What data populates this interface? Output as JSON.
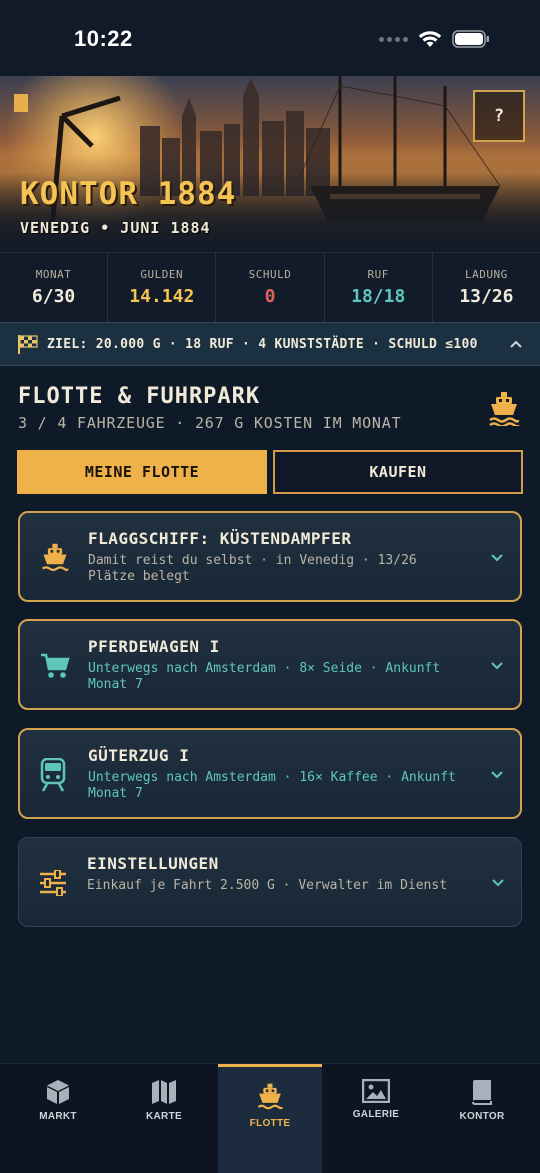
{
  "status_bar": {
    "time": "10:22"
  },
  "hero": {
    "title": "KONTOR 1884",
    "subtitle": "VENEDIG • JUNI 1884",
    "help_label": "?"
  },
  "stats": [
    {
      "label": "MONAT",
      "value": "6/30",
      "color": "#f1ead8"
    },
    {
      "label": "GULDEN",
      "value": "14.142",
      "color": "#f5c453"
    },
    {
      "label": "SCHULD",
      "value": "0",
      "color": "#e0625a"
    },
    {
      "label": "RUF",
      "value": "18/18",
      "color": "#5fc7b8"
    },
    {
      "label": "LADUNG",
      "value": "13/26",
      "color": "#f1ead8"
    }
  ],
  "goal": {
    "text": "ZIEL: 20.000 G · 18 RUF · 4 KUNSTSTÄDTE · SCHULD ≤100",
    "icon": "checkered-flag-icon"
  },
  "section": {
    "title": "FLOTTE & FUHRPARK",
    "subtitle": "3 / 4 FAHRZEUGE · 267 G KOSTEN IM MONAT",
    "icon": "ship-icon"
  },
  "tabs": {
    "fleet_label": "MEINE FLOTTE",
    "buy_label": "KAUFEN"
  },
  "cards": [
    {
      "title": "FLAGGSCHIFF: KÜSTENDAMPFER",
      "desc": "Damit reist du selbst · in Venedig · 13/26 Plätze belegt",
      "icon": "ship-icon",
      "desc_color": "#b9b4a6"
    },
    {
      "title": "PFERDEWAGEN I",
      "desc": "Unterwegs nach Amsterdam · 8× Seide · Ankunft Monat 7",
      "icon": "cart-icon",
      "desc_color": "#5fc7b8"
    },
    {
      "title": "GÜTERZUG I",
      "desc": "Unterwegs nach Amsterdam · 16× Kaffee · Ankunft Monat 7",
      "icon": "train-icon",
      "desc_color": "#5fc7b8"
    },
    {
      "title": "EINSTELLUNGEN",
      "desc": "Einkauf je Fahrt 2.500 G · Verwalter im Dienst",
      "icon": "sliders-icon",
      "desc_color": "#b9b4a6"
    }
  ],
  "nav": [
    {
      "label": "MARKT",
      "icon": "cube-icon"
    },
    {
      "label": "KARTE",
      "icon": "map-icon"
    },
    {
      "label": "FLOTTE",
      "icon": "ship-icon",
      "active": true
    },
    {
      "label": "GALERIE",
      "icon": "image-icon"
    },
    {
      "label": "KONTOR",
      "icon": "book-icon"
    }
  ],
  "colors": {
    "accent": "#efb24b",
    "teal": "#5fc7b8",
    "red": "#e0625a",
    "background": "#0f1a29"
  }
}
